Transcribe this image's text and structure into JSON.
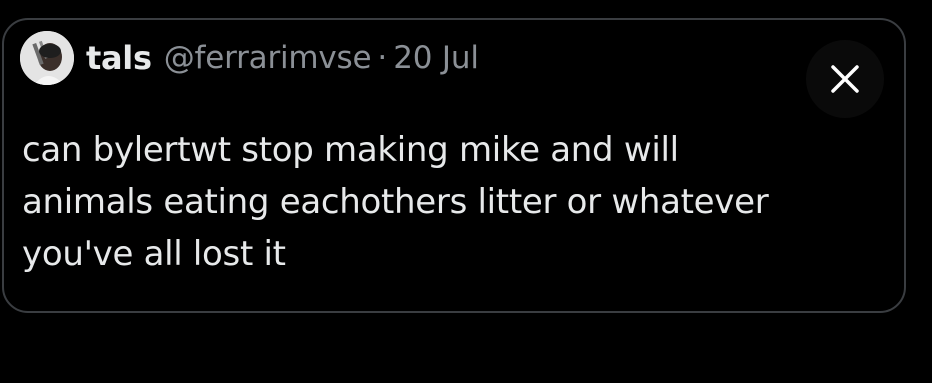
{
  "tweet": {
    "author_name": "tals",
    "author_handle": "@ferrarimvse",
    "separator": "·",
    "date": "20 Jul",
    "text_lines": [
      "can bylertwt stop making mike and will",
      "animals eating eachothers litter or whatever",
      "you've all lost it"
    ]
  },
  "icons": {
    "close": "close-icon",
    "avatar": "avatar-image"
  },
  "colors": {
    "background": "#000000",
    "border": "#3a3d41",
    "primary_text": "#e7e9ea",
    "secondary_text": "#8b9096"
  }
}
